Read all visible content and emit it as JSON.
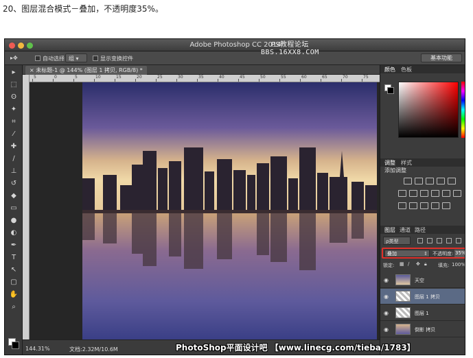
{
  "caption": "20、图层混合模式－叠加，不透明度35%。",
  "window": {
    "app_title": "Adobe Photoshop CC 2014",
    "watermark_top": "PS教程论坛\nBBS.16XX8.COM"
  },
  "options_bar": {
    "auto_select_label": "自动选择:",
    "auto_select_value": "组",
    "show_transform_label": "显示变换控件",
    "workspace_label": "基本功能"
  },
  "document_tab": {
    "label": "未标题-1 @ 144% (图层 1 拷贝, RGB/8) *"
  },
  "ruler": {
    "labels": [
      "5",
      "0",
      "5",
      "10",
      "15",
      "20",
      "25",
      "30",
      "35",
      "40",
      "45",
      "50",
      "55",
      "60",
      "65",
      "70",
      "75"
    ]
  },
  "status": {
    "zoom": "144.31%",
    "doc_size": "文档:2.32M/10.6M"
  },
  "watermark_bottom": "PhotoShop平面设计吧 【www.linecg.com/tieba/1783】",
  "panels": {
    "color_tabs": [
      "颜色",
      "色板"
    ],
    "adjust_tabs": [
      "调整",
      "样式"
    ],
    "adjust_title": "添加调整",
    "layers_tabs": [
      "图层",
      "通道",
      "路径"
    ],
    "kind_label": "ρ类型",
    "blend_mode": "叠加",
    "opacity_label": "不透明度:",
    "opacity_value": "35%",
    "lock_label": "锁定:",
    "fill_label": "填充:",
    "fill_value": "100%",
    "layers": [
      {
        "name": "天空",
        "active": false
      },
      {
        "name": "图层 1 拷贝",
        "active": true
      },
      {
        "name": "图层 1",
        "active": false
      },
      {
        "name": "倒影 拷贝",
        "active": false
      }
    ]
  }
}
